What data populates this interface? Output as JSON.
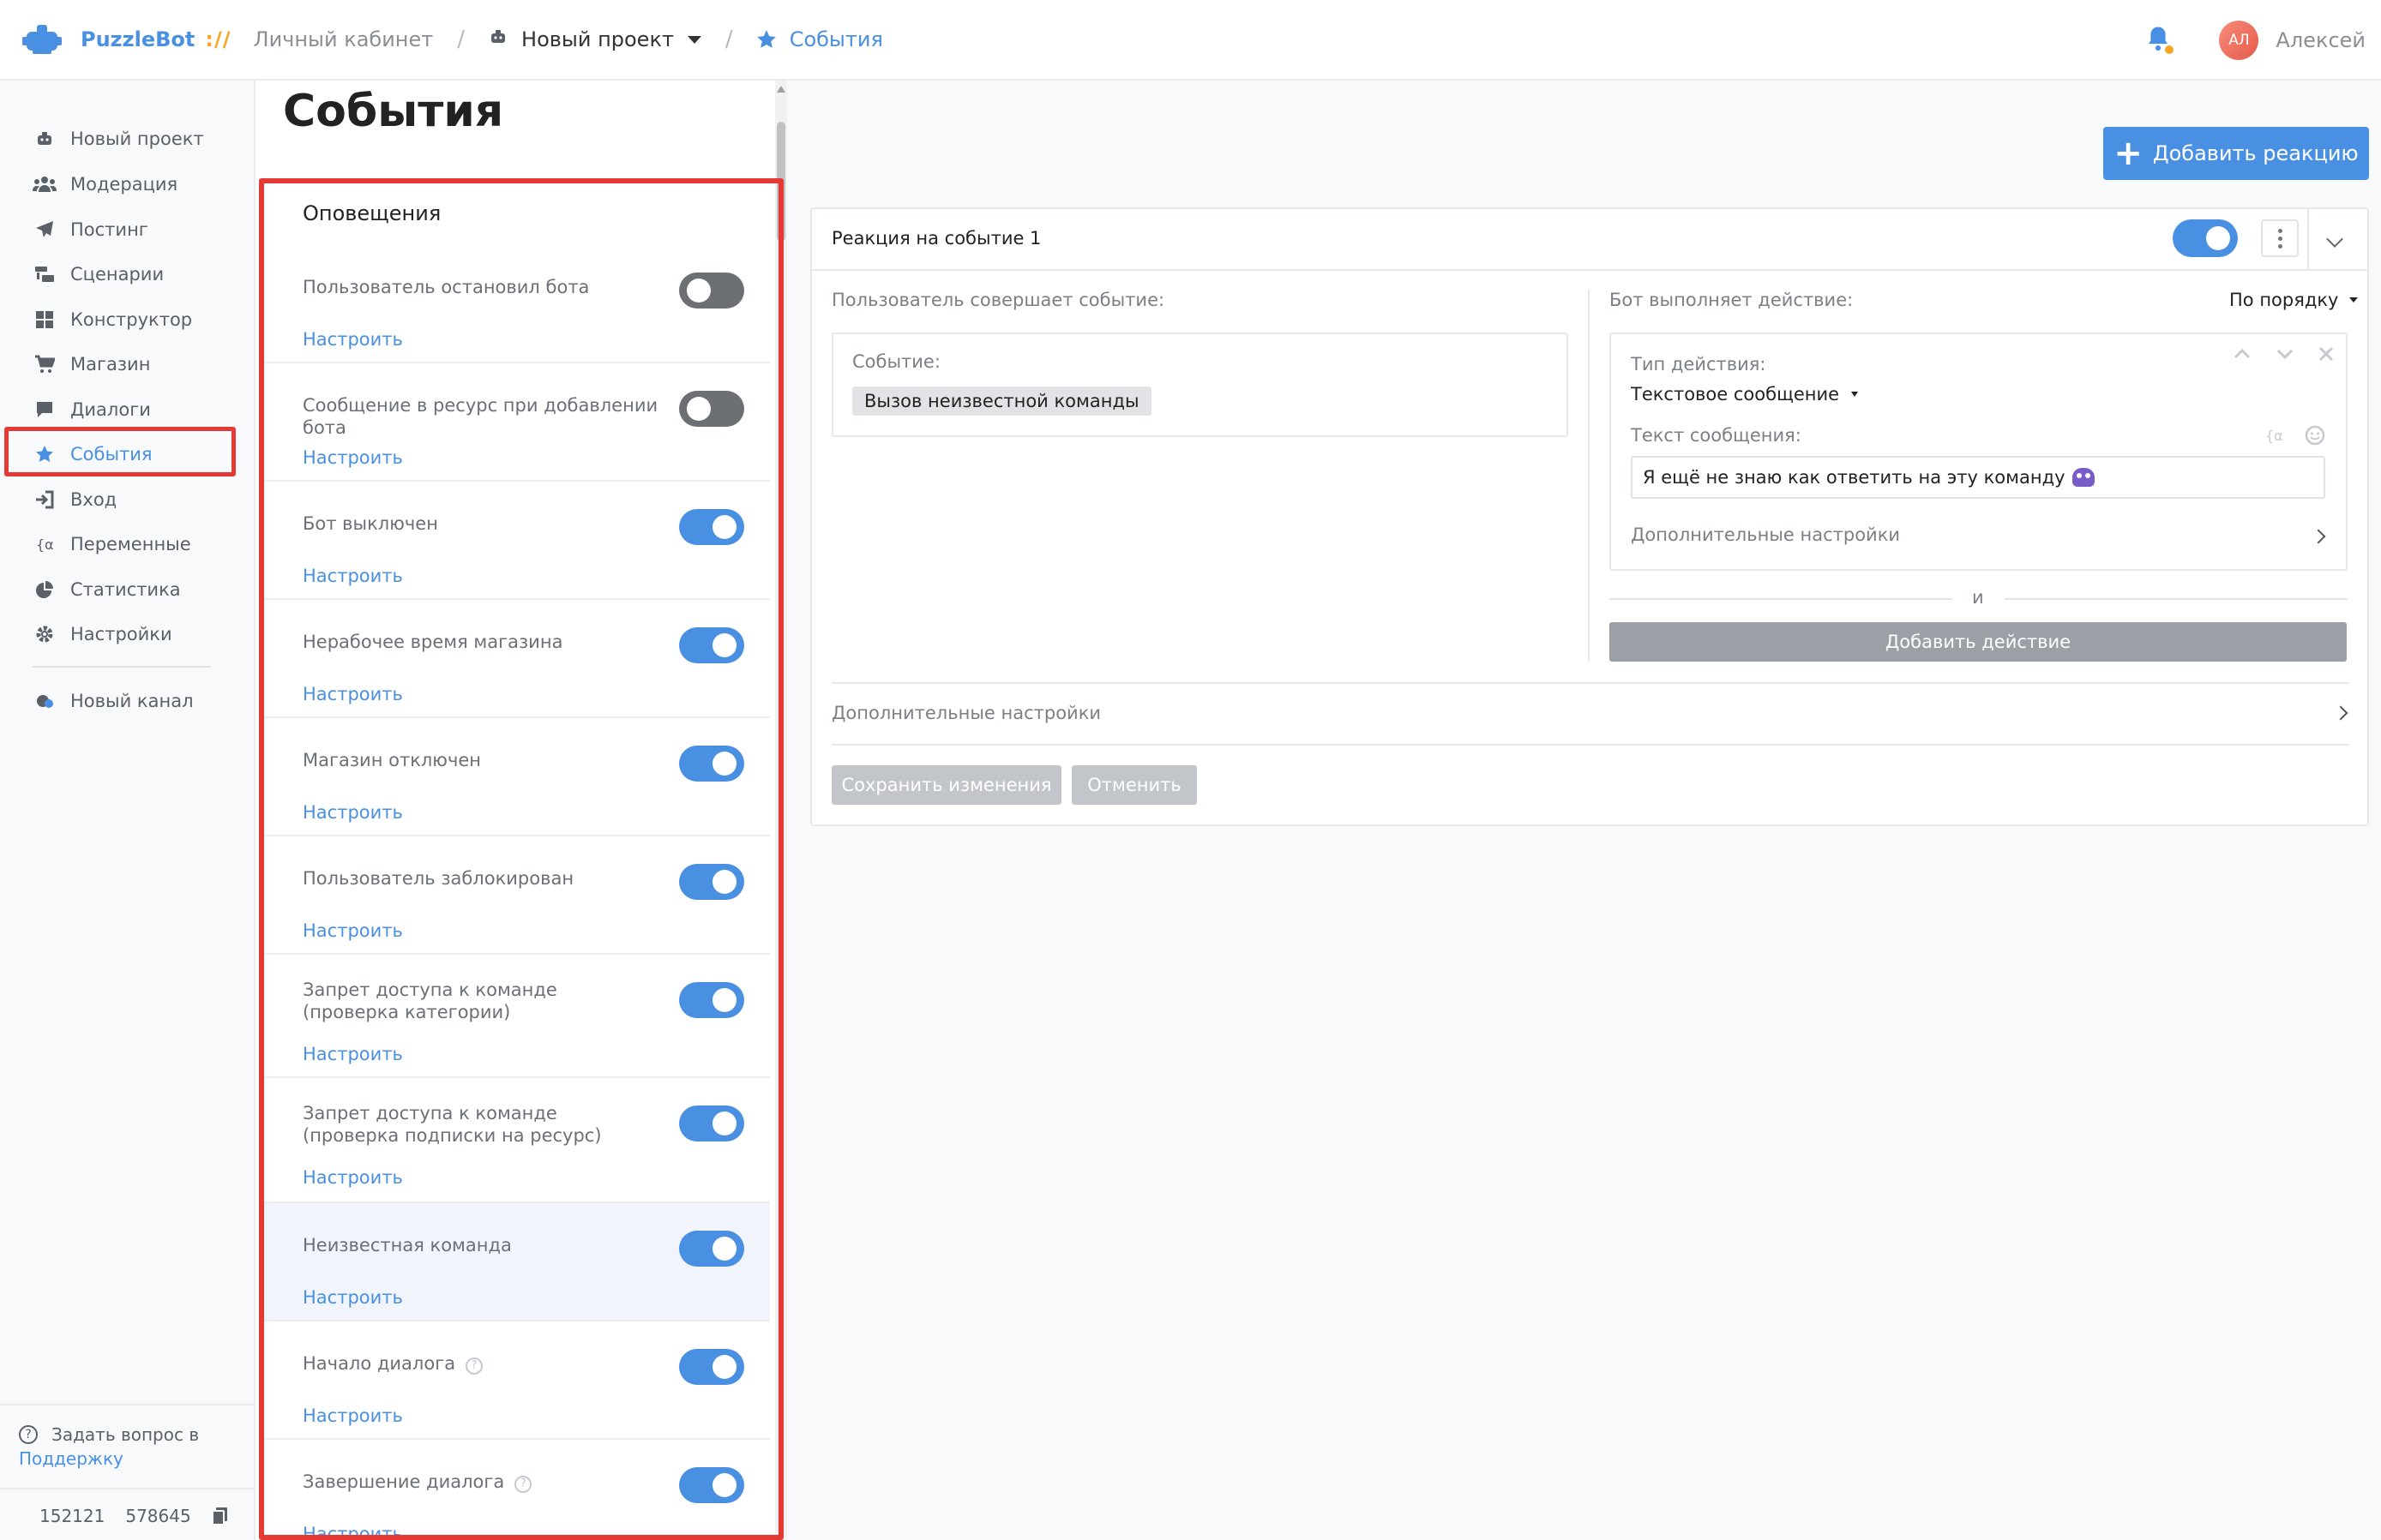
{
  "header": {
    "logo_text": "PuzzleBot",
    "logo_sep": "://",
    "crumb_cabinet": "Личный кабинет",
    "crumb_project": "Новый проект",
    "crumb_current": "События",
    "username": "Алексей",
    "avatar_initials": "АЛ"
  },
  "sidebar": {
    "items": [
      {
        "label": "Новый проект",
        "icon": "bot-icon"
      },
      {
        "label": "Модерация",
        "icon": "users-icon"
      },
      {
        "label": "Постинг",
        "icon": "send-icon"
      },
      {
        "label": "Сценарии",
        "icon": "scenarios-icon"
      },
      {
        "label": "Конструктор",
        "icon": "grid-icon"
      },
      {
        "label": "Магазин",
        "icon": "cart-icon"
      },
      {
        "label": "Диалоги",
        "icon": "chat-icon"
      },
      {
        "label": "События",
        "icon": "star-icon"
      },
      {
        "label": "Вход",
        "icon": "login-icon"
      },
      {
        "label": "Переменные",
        "icon": "variable-icon"
      },
      {
        "label": "Статистика",
        "icon": "pie-chart-icon"
      },
      {
        "label": "Настройки",
        "icon": "gear-icon"
      }
    ],
    "new_channel": "Новый канал",
    "help_text": "Задать вопрос в",
    "help_link": "Поддержку",
    "id1": "152121",
    "id2": "578645"
  },
  "events": {
    "title": "События",
    "section": "Оповещения",
    "configure": "Настроить",
    "items": [
      {
        "label": "Пользователь остановил бота",
        "on": false
      },
      {
        "label": "Сообщение в ресурс при добавлении бота",
        "on": false
      },
      {
        "label": "Бот выключен",
        "on": true
      },
      {
        "label": "Нерабочее время магазина",
        "on": true
      },
      {
        "label": "Магазин отключен",
        "on": true
      },
      {
        "label": "Пользователь заблокирован",
        "on": true
      },
      {
        "label": "Запрет доступа к команде (проверка категории)",
        "on": true
      },
      {
        "label": "Запрет доступа к команде (проверка подписки на ресурс)",
        "on": true
      },
      {
        "label": "Неизвестная команда",
        "on": true
      },
      {
        "label": "Начало диалога",
        "on": true,
        "help": "?"
      },
      {
        "label": "Завершение диалога",
        "on": true,
        "help": "?"
      }
    ]
  },
  "reaction": {
    "add_button": "Добавить реакцию",
    "title": "Реакция на событие 1",
    "user_event_label": "Пользователь совершает событие:",
    "event_label": "Событие:",
    "event_value": "Вызов неизвестной команды",
    "bot_action_label": "Бот выполняет действие:",
    "order_label": "По порядку",
    "action_type_label": "Тип действия:",
    "action_type_value": "Текстовое сообщение",
    "message_label": "Текст сообщения:",
    "message_value": "Я ещё не знаю как ответить на эту команду",
    "extra_settings": "Дополнительные настройки",
    "and_label": "и",
    "add_action": "Добавить действие",
    "save": "Сохранить изменения",
    "cancel": "Отменить"
  },
  "colors": {
    "accent": "#4a90e2",
    "highlight": "#e53935",
    "toggle_off": "#6c6f74"
  }
}
